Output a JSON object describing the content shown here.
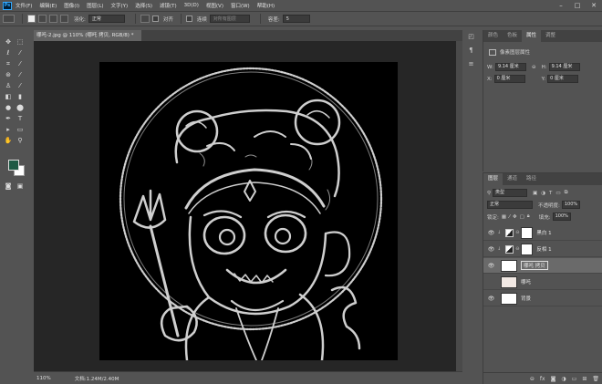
{
  "app": {
    "logo": "Ps"
  },
  "menu": [
    "文件(F)",
    "编辑(E)",
    "图像(I)",
    "图层(L)",
    "文字(Y)",
    "选择(S)",
    "滤镜(T)",
    "3D(D)",
    "视图(V)",
    "窗口(W)",
    "帮助(H)"
  ],
  "window_controls": {
    "minimize": "–",
    "maximize": "□",
    "close": "✕"
  },
  "options": {
    "feather_label": "羽化:",
    "mode_value": "正常",
    "align_label": "对齐",
    "sample_all_label": "连续",
    "sample_label": "对所有图层",
    "tolerance_label": "容差:",
    "tolerance_value": "5"
  },
  "document": {
    "tab_title": "哪吒-2.jpg @ 110% (哪吒 拷贝, RGB/8) *",
    "tab_close": "×"
  },
  "status": {
    "zoom": "110%",
    "doc_info": "文档:1.24M/2.40M"
  },
  "properties": {
    "tabs": [
      "颜色",
      "色板",
      "属性",
      "调整"
    ],
    "active_tab": "属性",
    "title": "像素图层属性",
    "w_label": "W:",
    "w_value": "9.14 厘米",
    "h_label": "H:",
    "h_value": "9.14 厘米",
    "x_label": "X:",
    "x_value": "0 厘米",
    "y_label": "Y:",
    "y_value": "0 厘米"
  },
  "layers_panel": {
    "tabs": [
      "图层",
      "通道",
      "路径"
    ],
    "filter_label": "类型",
    "blend_mode": "正常",
    "opacity_label": "不透明度:",
    "opacity_value": "100%",
    "lock_label": "锁定:",
    "fill_label": "填充:",
    "fill_value": "100%",
    "layers": [
      {
        "name": "黑白 1",
        "type": "adjustment",
        "visible": true
      },
      {
        "name": "反相 1",
        "type": "adjustment",
        "visible": true
      },
      {
        "name": "哪吒 拷贝",
        "type": "pixel",
        "visible": true,
        "selected": true
      },
      {
        "name": "哪吒",
        "type": "pixel",
        "visible": false
      },
      {
        "name": "背景",
        "type": "pixel",
        "visible": true
      }
    ],
    "footer_icons": [
      "link-icon",
      "fx-icon",
      "mask-icon",
      "adjustment-icon",
      "group-icon",
      "new-layer-icon",
      "trash-icon"
    ]
  },
  "colors": {
    "foreground": "#1e5a45",
    "background": "#ffffff",
    "chrome": "#535353",
    "canvas": "#000000"
  }
}
